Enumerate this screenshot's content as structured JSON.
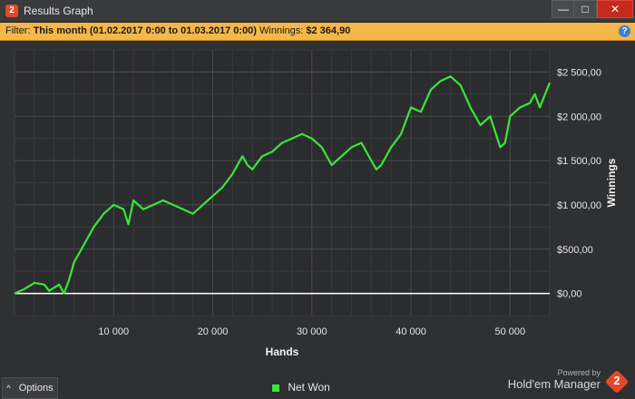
{
  "window": {
    "title": "Results Graph",
    "app_icon_text": "2",
    "buttons": {
      "minimize": "—",
      "maximize": "□",
      "close": "✕"
    }
  },
  "filter": {
    "prefix": "Filter:",
    "range": "This month (01.02.2017 0:00 to 01.03.2017 0:00)",
    "winnings_label": "Winnings:",
    "winnings_value": "$2 364,90",
    "help_icon": "?"
  },
  "bottom": {
    "options_label": "Options",
    "options_icon": "^",
    "legend_label": "Net Won",
    "powered_by": "Powered by",
    "brand": "Hold'em Manager",
    "brand_logo_text": "2"
  },
  "colors": {
    "series": "#39e639",
    "plot_bg": "#2b2c2e",
    "accent": "#f6b74a"
  },
  "chart_data": {
    "type": "line",
    "xlabel": "Hands",
    "ylabel": "Winnings",
    "xlim": [
      0,
      54000
    ],
    "ylim": [
      -250,
      2750
    ],
    "x_ticks": [
      10000,
      20000,
      30000,
      40000,
      50000
    ],
    "x_tick_labels": [
      "10 000",
      "20 000",
      "30 000",
      "40 000",
      "50 000"
    ],
    "y_ticks": [
      0,
      500,
      1000,
      1500,
      2000,
      2500
    ],
    "y_tick_labels": [
      "$0,00",
      "$500,00",
      "$1 000,00",
      "$1 500,00",
      "$2 000,00",
      "$2 500,00"
    ],
    "grid": true,
    "series": [
      {
        "name": "Net Won",
        "x": [
          0,
          1000,
          2000,
          3000,
          3500,
          4500,
          5000,
          5500,
          6000,
          7000,
          8000,
          9000,
          10000,
          11000,
          11500,
          12000,
          13000,
          14000,
          15000,
          16000,
          17000,
          18000,
          19000,
          20000,
          21000,
          22000,
          23000,
          23500,
          24000,
          25000,
          26000,
          27000,
          28000,
          29000,
          30000,
          31000,
          32000,
          33000,
          34000,
          35000,
          36000,
          36500,
          37000,
          38000,
          39000,
          40000,
          41000,
          42000,
          43000,
          44000,
          45000,
          46000,
          47000,
          48000,
          49000,
          49500,
          50000,
          51000,
          52000,
          52500,
          53000,
          54000
        ],
        "y": [
          0,
          50,
          120,
          100,
          30,
          100,
          0,
          150,
          350,
          550,
          750,
          900,
          1000,
          950,
          780,
          1050,
          950,
          1000,
          1050,
          1000,
          950,
          900,
          1000,
          1100,
          1200,
          1350,
          1550,
          1450,
          1400,
          1550,
          1600,
          1700,
          1750,
          1800,
          1750,
          1650,
          1450,
          1550,
          1650,
          1700,
          1500,
          1400,
          1450,
          1650,
          1800,
          2100,
          2050,
          2300,
          2400,
          2450,
          2350,
          2100,
          1900,
          2000,
          1650,
          1700,
          2000,
          2100,
          2150,
          2250,
          2100,
          2380
        ]
      }
    ]
  }
}
